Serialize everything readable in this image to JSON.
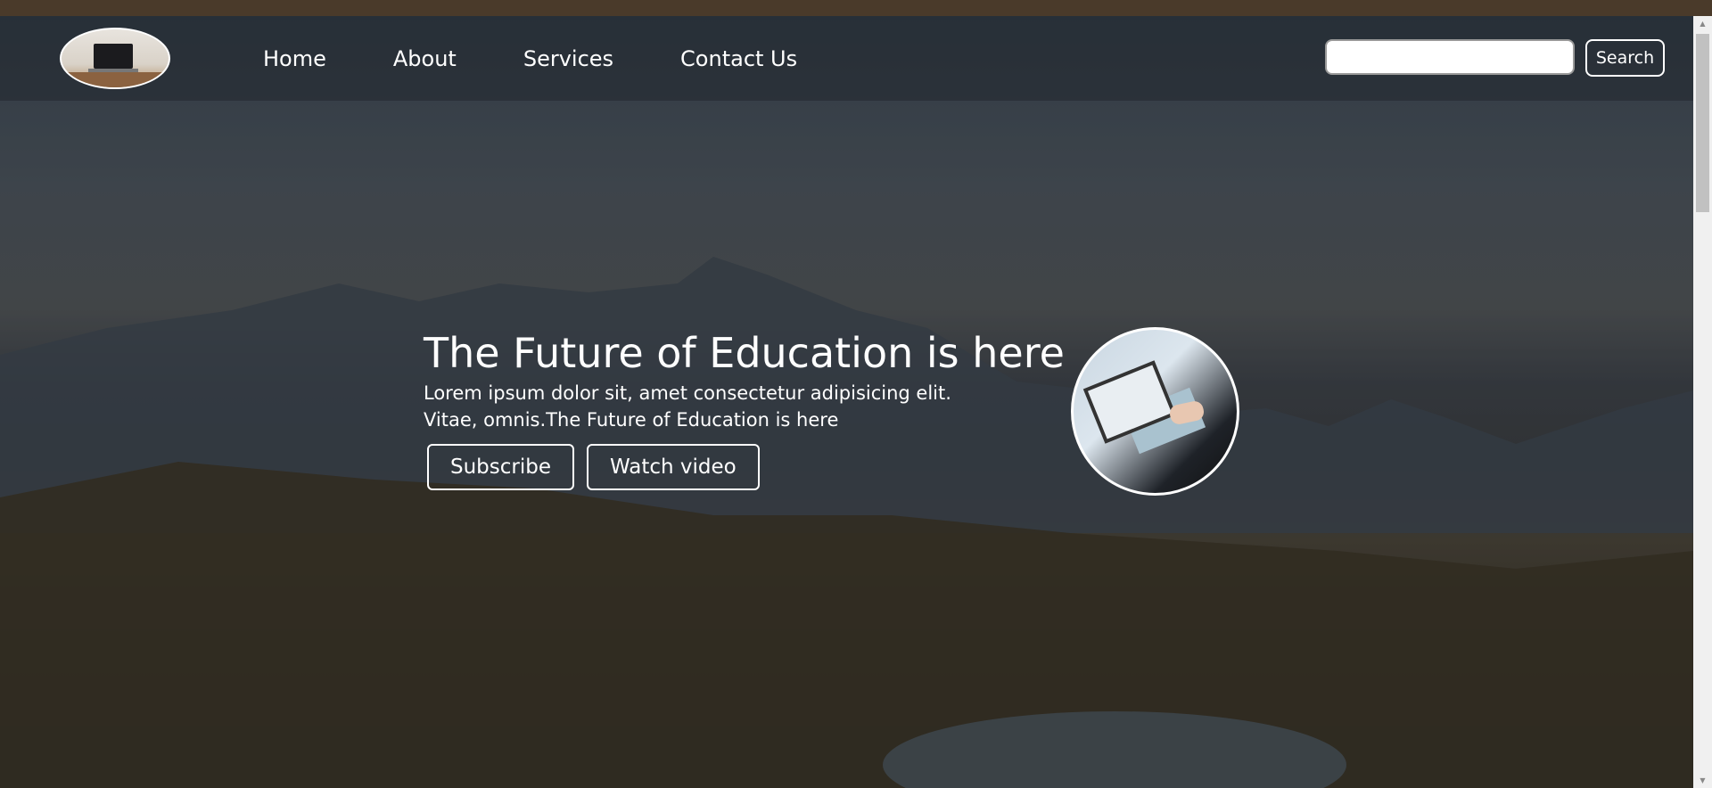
{
  "nav": {
    "logo_icon": "laptop-on-desk-logo",
    "links": [
      "Home",
      "About",
      "Services",
      "Contact Us"
    ]
  },
  "search": {
    "placeholder": "",
    "button_label": "Search"
  },
  "hero": {
    "title": "The Future of Education is here",
    "text": "Lorem ipsum dolor sit, amet consectetur adipisicing elit. Vitae, omnis.The Future of Education is here",
    "buttons": [
      "Subscribe",
      "Watch video"
    ],
    "image_icon": "person-using-tablet-image"
  },
  "scrollbar": {
    "up_icon": "triangle-up-icon",
    "down_icon": "triangle-down-icon"
  },
  "colors": {
    "text": "#ffffff",
    "browser_strip": "#4a3a2a",
    "overlay": "#1c2228"
  }
}
